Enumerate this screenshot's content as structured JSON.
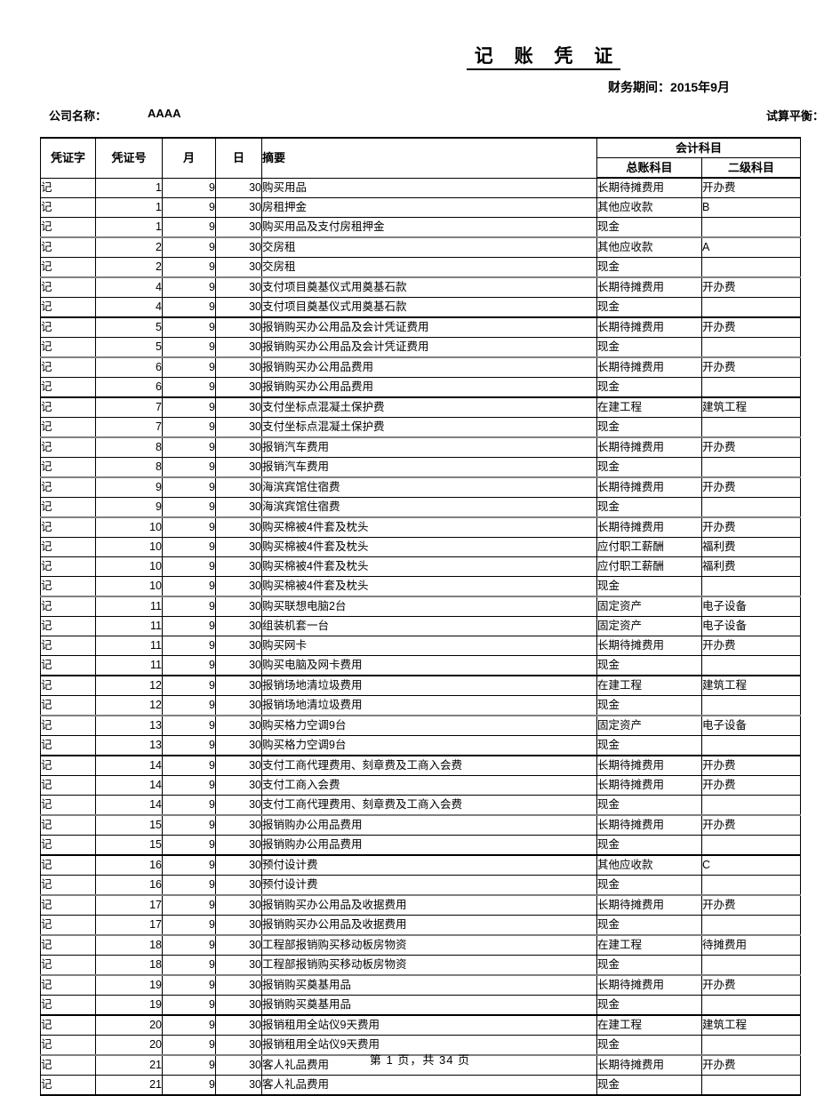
{
  "document": {
    "title": "记 账 凭 证",
    "period": "财务期间：2015年9月",
    "company_label": "公司名称：",
    "company_value": "AAAA",
    "balance_label": "试算平衡：",
    "footer": "第 1 页，共 34 页"
  },
  "table": {
    "headers": {
      "voucher_word": "凭证字",
      "voucher_no": "凭证号",
      "month": "月",
      "day": "日",
      "summary": "摘要",
      "account_group": "会计科目",
      "general_ledger": "总账科目",
      "sub_account": "二级科目"
    },
    "rows": [
      {
        "zi": "记",
        "hao": "1",
        "yue": "9",
        "ri": "30",
        "zhaiyao": "购买用品",
        "zong": "长期待摊费用",
        "erji": "开办费",
        "sep": ""
      },
      {
        "zi": "记",
        "hao": "1",
        "yue": "9",
        "ri": "30",
        "zhaiyao": "房租押金",
        "zong": "其他应收款",
        "erji": "B",
        "sep": ""
      },
      {
        "zi": "记",
        "hao": "1",
        "yue": "9",
        "ri": "30",
        "zhaiyao": "购买用品及支付房租押金",
        "zong": "现金",
        "erji": "",
        "sep": "grp"
      },
      {
        "zi": "记",
        "hao": "2",
        "yue": "9",
        "ri": "30",
        "zhaiyao": "交房租",
        "zong": "其他应收款",
        "erji": "A",
        "sep": ""
      },
      {
        "zi": "记",
        "hao": "2",
        "yue": "9",
        "ri": "30",
        "zhaiyao": "交房租",
        "zong": "现金",
        "erji": "",
        "sep": "grp"
      },
      {
        "zi": "记",
        "hao": "4",
        "yue": "9",
        "ri": "30",
        "zhaiyao": "支付项目奠基仪式用奠基石款",
        "zong": "长期待摊费用",
        "erji": "开办费",
        "sep": ""
      },
      {
        "zi": "记",
        "hao": "4",
        "yue": "9",
        "ri": "30",
        "zhaiyao": "支付项目奠基仪式用奠基石款",
        "zong": "现金",
        "erji": "",
        "sep": "grpdark"
      },
      {
        "zi": "记",
        "hao": "5",
        "yue": "9",
        "ri": "30",
        "zhaiyao": "报销购买办公用品及会计凭证费用",
        "zong": "长期待摊费用",
        "erji": "开办费",
        "sep": ""
      },
      {
        "zi": "记",
        "hao": "5",
        "yue": "9",
        "ri": "30",
        "zhaiyao": "报销购买办公用品及会计凭证费用",
        "zong": "现金",
        "erji": "",
        "sep": "grp"
      },
      {
        "zi": "记",
        "hao": "6",
        "yue": "9",
        "ri": "30",
        "zhaiyao": "报销购买办公用品费用",
        "zong": "长期待摊费用",
        "erji": "开办费",
        "sep": ""
      },
      {
        "zi": "记",
        "hao": "6",
        "yue": "9",
        "ri": "30",
        "zhaiyao": "报销购买办公用品费用",
        "zong": "现金",
        "erji": "",
        "sep": "grpdark"
      },
      {
        "zi": "记",
        "hao": "7",
        "yue": "9",
        "ri": "30",
        "zhaiyao": "支付坐标点混凝土保护费",
        "zong": "在建工程",
        "erji": "建筑工程",
        "sep": ""
      },
      {
        "zi": "记",
        "hao": "7",
        "yue": "9",
        "ri": "30",
        "zhaiyao": "支付坐标点混凝土保护费",
        "zong": "现金",
        "erji": "",
        "sep": "grp"
      },
      {
        "zi": "记",
        "hao": "8",
        "yue": "9",
        "ri": "30",
        "zhaiyao": "报销汽车费用",
        "zong": "长期待摊费用",
        "erji": "开办费",
        "sep": ""
      },
      {
        "zi": "记",
        "hao": "8",
        "yue": "9",
        "ri": "30",
        "zhaiyao": "报销汽车费用",
        "zong": "现金",
        "erji": "",
        "sep": "grp"
      },
      {
        "zi": "记",
        "hao": "9",
        "yue": "9",
        "ri": "30",
        "zhaiyao": "海滨宾馆住宿费",
        "zong": "长期待摊费用",
        "erji": "开办费",
        "sep": ""
      },
      {
        "zi": "记",
        "hao": "9",
        "yue": "9",
        "ri": "30",
        "zhaiyao": "海滨宾馆住宿费",
        "zong": "现金",
        "erji": "",
        "sep": "grp"
      },
      {
        "zi": "记",
        "hao": "10",
        "yue": "9",
        "ri": "30",
        "zhaiyao": "购买棉被4件套及枕头",
        "zong": "长期待摊费用",
        "erji": "开办费",
        "sep": ""
      },
      {
        "zi": "记",
        "hao": "10",
        "yue": "9",
        "ri": "30",
        "zhaiyao": "购买棉被4件套及枕头",
        "zong": "应付职工薪酬",
        "erji": "福利费",
        "sep": ""
      },
      {
        "zi": "记",
        "hao": "10",
        "yue": "9",
        "ri": "30",
        "zhaiyao": "购买棉被4件套及枕头",
        "zong": "应付职工薪酬",
        "erji": "福利费",
        "sep": ""
      },
      {
        "zi": "记",
        "hao": "10",
        "yue": "9",
        "ri": "30",
        "zhaiyao": "购买棉被4件套及枕头",
        "zong": "现金",
        "erji": "",
        "sep": "grp"
      },
      {
        "zi": "记",
        "hao": "11",
        "yue": "9",
        "ri": "30",
        "zhaiyao": "购买联想电脑2台",
        "zong": "固定资产",
        "erji": "电子设备",
        "sep": ""
      },
      {
        "zi": "记",
        "hao": "11",
        "yue": "9",
        "ri": "30",
        "zhaiyao": "组装机套一台",
        "zong": "固定资产",
        "erji": "电子设备",
        "sep": ""
      },
      {
        "zi": "记",
        "hao": "11",
        "yue": "9",
        "ri": "30",
        "zhaiyao": "购买网卡",
        "zong": "长期待摊费用",
        "erji": "开办费",
        "sep": ""
      },
      {
        "zi": "记",
        "hao": "11",
        "yue": "9",
        "ri": "30",
        "zhaiyao": "购买电脑及网卡费用",
        "zong": "现金",
        "erji": "",
        "sep": "grpdark"
      },
      {
        "zi": "记",
        "hao": "12",
        "yue": "9",
        "ri": "30",
        "zhaiyao": "报销场地清垃圾费用",
        "zong": "在建工程",
        "erji": "建筑工程",
        "sep": ""
      },
      {
        "zi": "记",
        "hao": "12",
        "yue": "9",
        "ri": "30",
        "zhaiyao": "报销场地清垃圾费用",
        "zong": "现金",
        "erji": "",
        "sep": "grp"
      },
      {
        "zi": "记",
        "hao": "13",
        "yue": "9",
        "ri": "30",
        "zhaiyao": "购买格力空调9台",
        "zong": "固定资产",
        "erji": "电子设备",
        "sep": ""
      },
      {
        "zi": "记",
        "hao": "13",
        "yue": "9",
        "ri": "30",
        "zhaiyao": "购买格力空调9台",
        "zong": "现金",
        "erji": "",
        "sep": "grpdark"
      },
      {
        "zi": "记",
        "hao": "14",
        "yue": "9",
        "ri": "30",
        "zhaiyao": "支付工商代理费用、刻章费及工商入会费",
        "zong": "长期待摊费用",
        "erji": "开办费",
        "sep": ""
      },
      {
        "zi": "记",
        "hao": "14",
        "yue": "9",
        "ri": "30",
        "zhaiyao": "支付工商入会费",
        "zong": "长期待摊费用",
        "erji": "开办费",
        "sep": ""
      },
      {
        "zi": "记",
        "hao": "14",
        "yue": "9",
        "ri": "30",
        "zhaiyao": "支付工商代理费用、刻章费及工商入会费",
        "zong": "现金",
        "erji": "",
        "sep": "grp"
      },
      {
        "zi": "记",
        "hao": "15",
        "yue": "9",
        "ri": "30",
        "zhaiyao": "报销购办公用品费用",
        "zong": "长期待摊费用",
        "erji": "开办费",
        "sep": ""
      },
      {
        "zi": "记",
        "hao": "15",
        "yue": "9",
        "ri": "30",
        "zhaiyao": "报销购办公用品费用",
        "zong": "现金",
        "erji": "",
        "sep": "grpdark"
      },
      {
        "zi": "记",
        "hao": "16",
        "yue": "9",
        "ri": "30",
        "zhaiyao": "预付设计费",
        "zong": "其他应收款",
        "erji": "C",
        "sep": ""
      },
      {
        "zi": "记",
        "hao": "16",
        "yue": "9",
        "ri": "30",
        "zhaiyao": "预付设计费",
        "zong": "现金",
        "erji": "",
        "sep": "grp"
      },
      {
        "zi": "记",
        "hao": "17",
        "yue": "9",
        "ri": "30",
        "zhaiyao": "报销购买办公用品及收据费用",
        "zong": "长期待摊费用",
        "erji": "开办费",
        "sep": ""
      },
      {
        "zi": "记",
        "hao": "17",
        "yue": "9",
        "ri": "30",
        "zhaiyao": "报销购买办公用品及收据费用",
        "zong": "现金",
        "erji": "",
        "sep": "grp"
      },
      {
        "zi": "记",
        "hao": "18",
        "yue": "9",
        "ri": "30",
        "zhaiyao": "工程部报销购买移动板房物资",
        "zong": "在建工程",
        "erji": "待摊费用",
        "sep": ""
      },
      {
        "zi": "记",
        "hao": "18",
        "yue": "9",
        "ri": "30",
        "zhaiyao": "工程部报销购买移动板房物资",
        "zong": "现金",
        "erji": "",
        "sep": "grp"
      },
      {
        "zi": "记",
        "hao": "19",
        "yue": "9",
        "ri": "30",
        "zhaiyao": "报销购买奠基用品",
        "zong": "长期待摊费用",
        "erji": "开办费",
        "sep": ""
      },
      {
        "zi": "记",
        "hao": "19",
        "yue": "9",
        "ri": "30",
        "zhaiyao": "报销购买奠基用品",
        "zong": "现金",
        "erji": "",
        "sep": "grpdark"
      },
      {
        "zi": "记",
        "hao": "20",
        "yue": "9",
        "ri": "30",
        "zhaiyao": "报销租用全站仪9天费用",
        "zong": "在建工程",
        "erji": "建筑工程",
        "sep": ""
      },
      {
        "zi": "记",
        "hao": "20",
        "yue": "9",
        "ri": "30",
        "zhaiyao": "报销租用全站仪9天费用",
        "zong": "现金",
        "erji": "",
        "sep": "grp"
      },
      {
        "zi": "记",
        "hao": "21",
        "yue": "9",
        "ri": "30",
        "zhaiyao": "客人礼品费用",
        "zong": "长期待摊费用",
        "erji": "开办费",
        "sep": ""
      },
      {
        "zi": "记",
        "hao": "21",
        "yue": "9",
        "ri": "30",
        "zhaiyao": "客人礼品费用",
        "zong": "现金",
        "erji": "",
        "sep": ""
      }
    ]
  }
}
